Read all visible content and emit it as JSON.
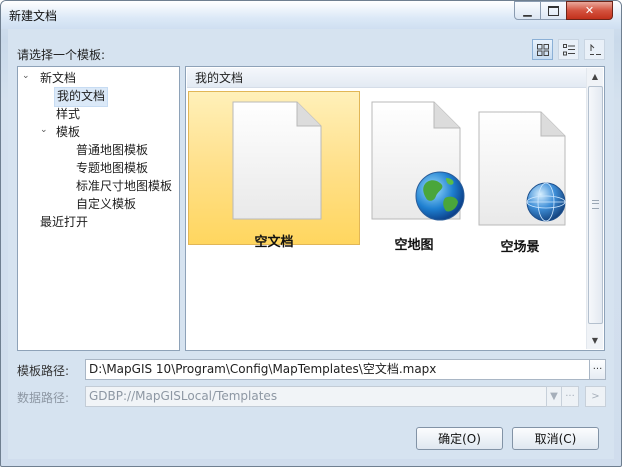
{
  "window": {
    "title": "新建文档"
  },
  "dialog": {
    "prompt": "请选择一个模板:",
    "tree": [
      {
        "label": "新文档",
        "level": 0,
        "toggle": "⌄",
        "selected": false
      },
      {
        "label": "我的文档",
        "level": 1,
        "toggle": "",
        "selected": true
      },
      {
        "label": "样式",
        "level": 1,
        "toggle": "",
        "selected": false
      },
      {
        "label": "模板",
        "level": 1,
        "toggle": "⌄",
        "selected": false
      },
      {
        "label": "普通地图模板",
        "level": 2,
        "toggle": "",
        "selected": false
      },
      {
        "label": "专题地图模板",
        "level": 2,
        "toggle": "",
        "selected": false
      },
      {
        "label": "标准尺寸地图模板",
        "level": 2,
        "toggle": "",
        "selected": false
      },
      {
        "label": "自定义模板",
        "level": 2,
        "toggle": "",
        "selected": false
      },
      {
        "label": "最近打开",
        "level": 0,
        "toggle": "",
        "selected": false
      }
    ],
    "gallery": {
      "header": "我的文档",
      "items": [
        {
          "label": "空文档",
          "icon": "blank-document-icon",
          "selected": true
        },
        {
          "label": "空地图",
          "icon": "map-document-icon",
          "selected": false
        },
        {
          "label": "空场景",
          "icon": "scene-document-icon",
          "selected": false
        }
      ]
    },
    "template_path": {
      "label": "模板路径:",
      "value": "D:\\MapGIS 10\\Program\\Config\\MapTemplates\\空文档.mapx"
    },
    "data_path": {
      "label": "数据路径:",
      "value": "GDBP://MapGISLocal/Templates"
    },
    "ok_label": "确定(O)",
    "cancel_label": "取消(C)",
    "browse_label": "···",
    "go_label": ">"
  }
}
